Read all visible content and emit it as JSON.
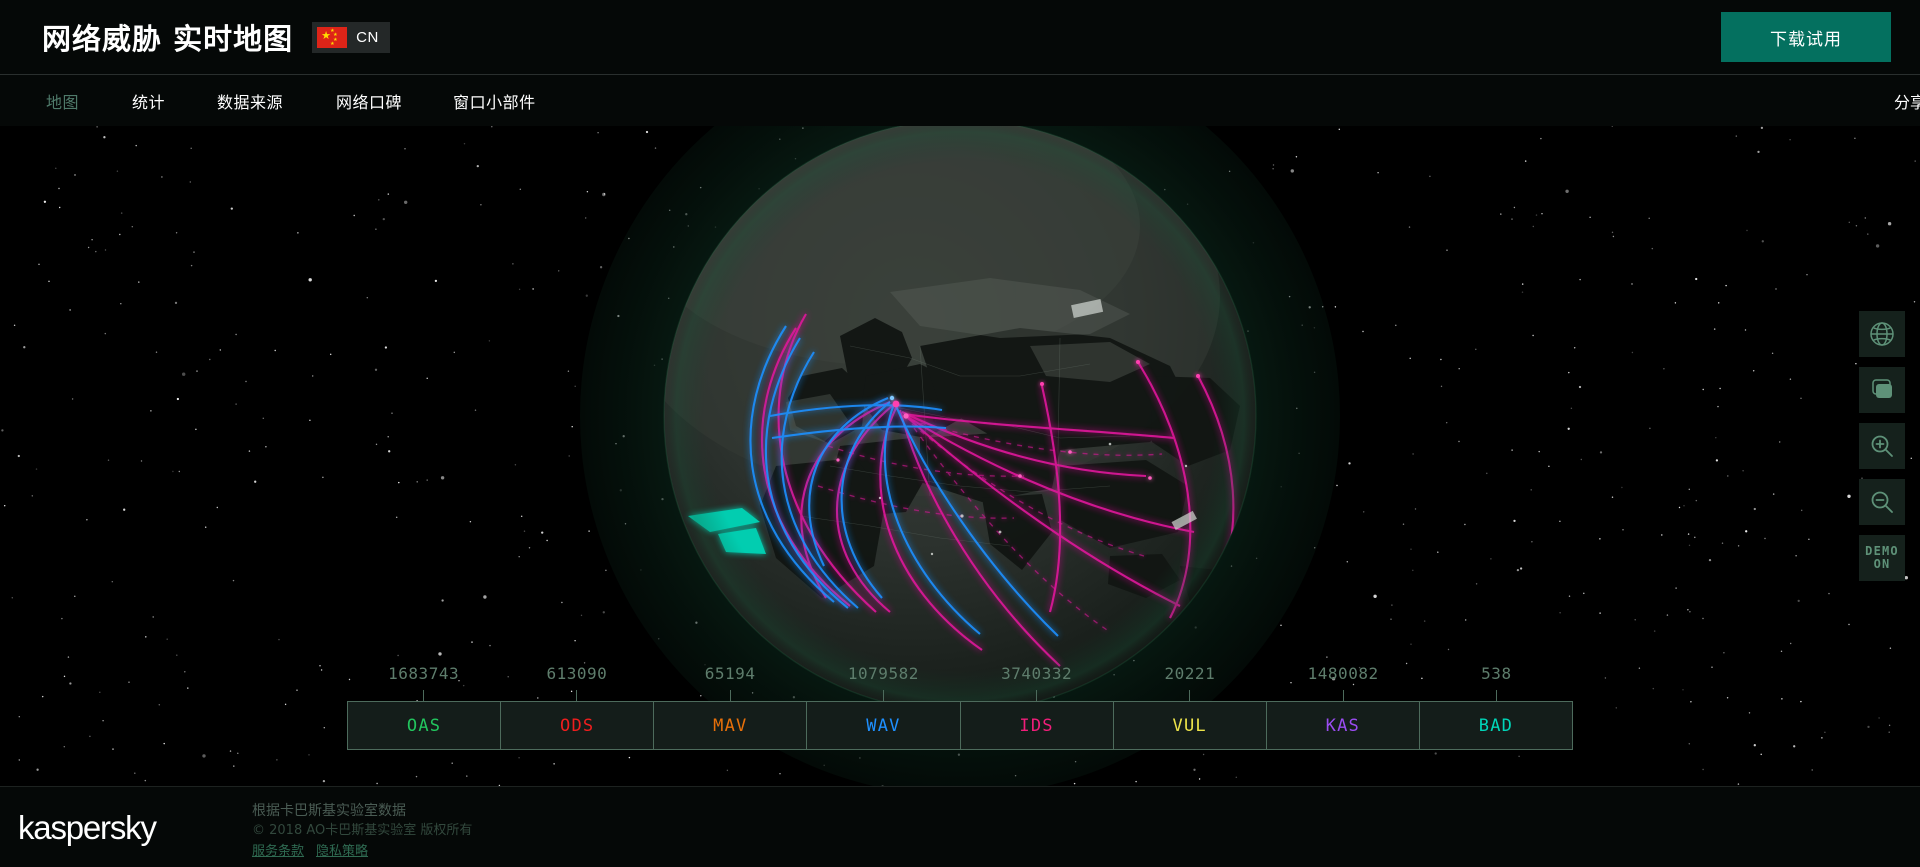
{
  "header": {
    "title": "网络威胁 实时地图",
    "country_code": "CN",
    "flag_icon": "cn-flag-icon",
    "download_label": "下载试用",
    "download_color": "#04705f"
  },
  "nav": {
    "items": [
      {
        "label": "地图",
        "active": true
      },
      {
        "label": "统计",
        "active": false
      },
      {
        "label": "数据来源",
        "active": false
      },
      {
        "label": "网络口碑",
        "active": false
      },
      {
        "label": "窗口小部件",
        "active": false
      }
    ],
    "share_label": "分享",
    "active_color": "#4f7a6a"
  },
  "legend": {
    "items": [
      {
        "code": "OAS",
        "value": "1683743",
        "color": "#22c55e"
      },
      {
        "code": "ODS",
        "value": "613090",
        "color": "#f01e1e"
      },
      {
        "code": "MAV",
        "value": "65194",
        "color": "#e8700a"
      },
      {
        "code": "WAV",
        "value": "1079582",
        "color": "#1e90ff"
      },
      {
        "code": "IDS",
        "value": "3740332",
        "color": "#f01e7a"
      },
      {
        "code": "VUL",
        "value": "20221",
        "color": "#ece34a"
      },
      {
        "code": "KAS",
        "value": "1480082",
        "color": "#9a4cf0"
      },
      {
        "code": "BAD",
        "value": "538",
        "color": "#00d6b8"
      }
    ],
    "value_color": "#5e7d6c",
    "border_color": "#4d6b5c",
    "cell_background": "#141d1a"
  },
  "toolbar": {
    "buttons": [
      {
        "name": "globe-icon",
        "label": ""
      },
      {
        "name": "flat-map-icon",
        "label": ""
      },
      {
        "name": "zoom-in-icon",
        "label": ""
      },
      {
        "name": "zoom-out-icon",
        "label": ""
      }
    ],
    "demo_line1": "DEMO",
    "demo_line2": "ON",
    "icon_color": "#5e9178"
  },
  "footer": {
    "logo_text": "kaspersky",
    "line1": "根据卡巴斯基实验室数据",
    "line2": "© 2018 AO卡巴斯基实验室 版权所有",
    "links": [
      {
        "label": "服务条款"
      },
      {
        "label": "隐私策略"
      }
    ]
  },
  "map": {
    "globe_glow_color": "#0e3222",
    "land_color": "#4b514c",
    "attack_colors": {
      "ids": "#e0189b",
      "wav": "#1e90ff",
      "bad": "#00d6b8"
    }
  }
}
